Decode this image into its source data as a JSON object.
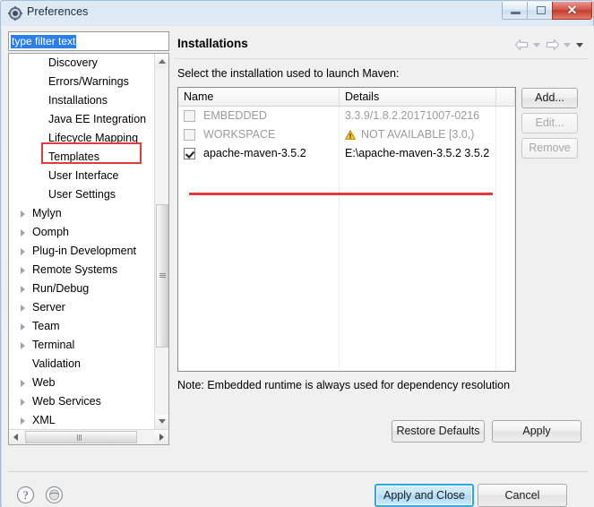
{
  "window": {
    "title": "Preferences",
    "icon": "preferences-gear-icon",
    "buttons": {
      "minimize": "minimize-icon",
      "maximize": "maximize-icon",
      "close": "✕"
    }
  },
  "sidebar": {
    "filter": {
      "value": "type filter text",
      "placeholder": "type filter text",
      "selected": true
    },
    "items": [
      {
        "label": "Discovery",
        "level": 2,
        "expandable": false,
        "selected": false
      },
      {
        "label": "Errors/Warnings",
        "level": 2,
        "expandable": false,
        "selected": false
      },
      {
        "label": "Installations",
        "level": 2,
        "expandable": false,
        "selected": true
      },
      {
        "label": "Java EE Integration",
        "level": 2,
        "expandable": false,
        "selected": false
      },
      {
        "label": "Lifecycle Mapping",
        "level": 2,
        "expandable": false,
        "selected": false
      },
      {
        "label": "Templates",
        "level": 2,
        "expandable": false,
        "selected": false
      },
      {
        "label": "User Interface",
        "level": 2,
        "expandable": false,
        "selected": false
      },
      {
        "label": "User Settings",
        "level": 2,
        "expandable": false,
        "selected": false
      },
      {
        "label": "Mylyn",
        "level": 1,
        "expandable": true,
        "selected": false
      },
      {
        "label": "Oomph",
        "level": 1,
        "expandable": true,
        "selected": false
      },
      {
        "label": "Plug-in Development",
        "level": 1,
        "expandable": true,
        "selected": false
      },
      {
        "label": "Remote Systems",
        "level": 1,
        "expandable": true,
        "selected": false
      },
      {
        "label": "Run/Debug",
        "level": 1,
        "expandable": true,
        "selected": false
      },
      {
        "label": "Server",
        "level": 1,
        "expandable": true,
        "selected": false
      },
      {
        "label": "Team",
        "level": 1,
        "expandable": true,
        "selected": false
      },
      {
        "label": "Terminal",
        "level": 1,
        "expandable": true,
        "selected": false
      },
      {
        "label": "Validation",
        "level": 1,
        "expandable": false,
        "selected": false
      },
      {
        "label": "Web",
        "level": 1,
        "expandable": true,
        "selected": false
      },
      {
        "label": "Web Services",
        "level": 1,
        "expandable": true,
        "selected": false
      },
      {
        "label": "XML",
        "level": 1,
        "expandable": true,
        "selected": false
      }
    ]
  },
  "main": {
    "title": "Installations",
    "description": "Select the installation used to launch Maven:",
    "nav": {
      "back": "back-arrow-icon",
      "back_menu": "back-dropdown-icon",
      "forward": "forward-arrow-icon",
      "forward_menu": "forward-dropdown-icon",
      "view_menu": "view-menu-icon"
    },
    "table": {
      "columns": [
        "Name",
        "Details"
      ],
      "rows": [
        {
          "checked": false,
          "enabled": false,
          "name": "EMBEDDED",
          "details": "3.3.9/1.8.2.20171007-0216",
          "warning": false
        },
        {
          "checked": false,
          "enabled": false,
          "name": "WORKSPACE",
          "details": "NOT AVAILABLE [3.0,)",
          "warning": true
        },
        {
          "checked": true,
          "enabled": true,
          "name": "apache-maven-3.5.2",
          "details": "E:\\apache-maven-3.5.2 3.5.2",
          "warning": false
        }
      ]
    },
    "side_buttons": [
      {
        "label": "Add...",
        "enabled": true
      },
      {
        "label": "Edit...",
        "enabled": false
      },
      {
        "label": "Remove",
        "enabled": false
      }
    ],
    "note": "Note: Embedded runtime is always used for dependency resolution",
    "restore_defaults": "Restore Defaults",
    "apply": "Apply"
  },
  "footer": {
    "help_icon": "help-question-icon",
    "secondary_icon": "oomph-record-icon",
    "apply_and_close": "Apply and Close",
    "cancel": "Cancel"
  },
  "annotations": {
    "highlight_color": "#e03a3a"
  }
}
